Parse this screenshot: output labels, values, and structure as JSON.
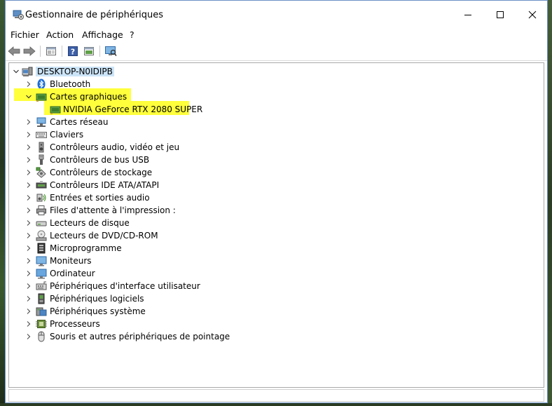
{
  "window": {
    "title": "Gestionnaire de périphériques",
    "controls": {
      "minimize": "minimize-icon",
      "maximize": "maximize-icon",
      "close": "close-icon"
    }
  },
  "menu": [
    {
      "label": "Fichier"
    },
    {
      "label": "Action"
    },
    {
      "label": "Affichage"
    },
    {
      "label": "?"
    }
  ],
  "toolbar": [
    "back-arrow-icon",
    "forward-arrow-icon",
    "properties-icon",
    "help-icon",
    "update-driver-icon",
    "scan-hardware-icon"
  ],
  "tree": {
    "root": "DESKTOP-N0IDIPB",
    "highlight_color": "#ffff3c",
    "categories": [
      {
        "label": "Bluetooth",
        "icon": "bluetooth-icon",
        "expanded": false
      },
      {
        "label": "Cartes graphiques",
        "icon": "display-adapter-icon",
        "expanded": true,
        "highlighted": true,
        "children": [
          {
            "label": "NVIDIA GeForce RTX 2080 SUPER",
            "icon": "gpu-icon",
            "highlighted": true
          }
        ]
      },
      {
        "label": "Cartes réseau",
        "icon": "network-adapter-icon",
        "expanded": false
      },
      {
        "label": "Claviers",
        "icon": "keyboard-icon",
        "expanded": false
      },
      {
        "label": "Contrôleurs audio, vidéo et jeu",
        "icon": "audio-icon",
        "expanded": false
      },
      {
        "label": "Contrôleurs de bus USB",
        "icon": "usb-icon",
        "expanded": false
      },
      {
        "label": "Contrôleurs de stockage",
        "icon": "storage-controller-icon",
        "expanded": false
      },
      {
        "label": "Contrôleurs IDE ATA/ATAPI",
        "icon": "ide-controller-icon",
        "expanded": false
      },
      {
        "label": "Entrées et sorties audio",
        "icon": "audio-io-icon",
        "expanded": false
      },
      {
        "label": "Files d'attente à l'impression :",
        "icon": "printer-icon",
        "expanded": false
      },
      {
        "label": "Lecteurs de disque",
        "icon": "disk-drive-icon",
        "expanded": false
      },
      {
        "label": "Lecteurs de DVD/CD-ROM",
        "icon": "dvd-drive-icon",
        "expanded": false
      },
      {
        "label": "Microprogramme",
        "icon": "firmware-icon",
        "expanded": false
      },
      {
        "label": "Moniteurs",
        "icon": "monitor-icon",
        "expanded": false
      },
      {
        "label": "Ordinateur",
        "icon": "computer-icon",
        "expanded": false
      },
      {
        "label": "Périphériques d'interface utilisateur",
        "icon": "hid-icon",
        "expanded": false
      },
      {
        "label": "Périphériques logiciels",
        "icon": "software-device-icon",
        "expanded": false
      },
      {
        "label": "Périphériques système",
        "icon": "system-device-icon",
        "expanded": false
      },
      {
        "label": "Processeurs",
        "icon": "processor-icon",
        "expanded": false
      },
      {
        "label": "Souris et autres périphériques de pointage",
        "icon": "mouse-icon",
        "expanded": false
      }
    ]
  }
}
